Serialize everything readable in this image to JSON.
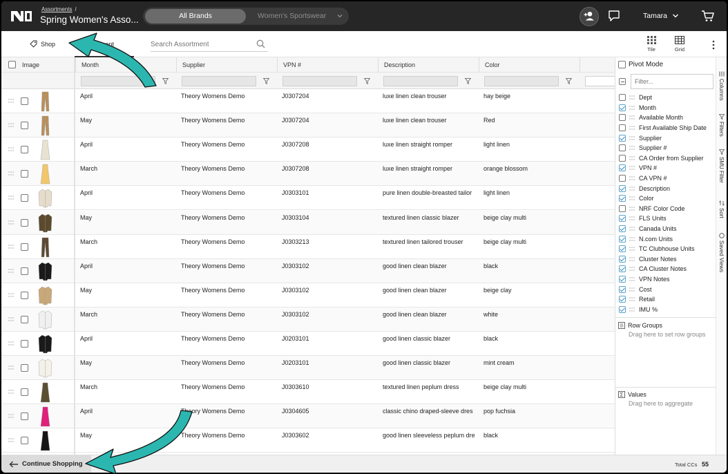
{
  "header": {
    "breadcrumb": "Assortments",
    "breadcrumb_sep": "/",
    "title": "Spring Women's Asso...",
    "brand_active": "All Brands",
    "brand_other": "Women's Sportswear",
    "user_name": "Tamara"
  },
  "toolbar": {
    "shop_label": "Shop",
    "assortment_label": "ment",
    "search_placeholder": "Search Assortment",
    "tile_label": "Tile",
    "grid_label": "Grid"
  },
  "grid": {
    "columns": [
      "Image",
      "Month",
      "Supplier",
      "VPN #",
      "Description",
      "Color"
    ],
    "rows": [
      {
        "month": "April",
        "supplier": "Theory Womens Demo",
        "vpn": "J0307204",
        "description": "luxe linen clean trouser",
        "color": "hay beige",
        "swatch": "#b8905e",
        "shape": "pants"
      },
      {
        "month": "May",
        "supplier": "Theory Womens Demo",
        "vpn": "J0307204",
        "description": "luxe linen clean trouser",
        "color": "Red",
        "swatch": "#b8905e",
        "shape": "pants"
      },
      {
        "month": "April",
        "supplier": "Theory Womens Demo",
        "vpn": "J0307208",
        "description": "luxe linen straight romper",
        "color": "light linen",
        "swatch": "#e8e2d0",
        "shape": "dress"
      },
      {
        "month": "March",
        "supplier": "Theory Womens Demo",
        "vpn": "J0307208",
        "description": "luxe linen straight romper",
        "color": "orange blossom",
        "swatch": "#f2c76b",
        "shape": "dress"
      },
      {
        "month": "April",
        "supplier": "Theory Womens Demo",
        "vpn": "J0303101",
        "description": "pure linen double-breasted tailor",
        "color": "light linen",
        "swatch": "#e6dccb",
        "shape": "jacket"
      },
      {
        "month": "May",
        "supplier": "Theory Womens Demo",
        "vpn": "J0303104",
        "description": "textured linen classic blazer",
        "color": "beige clay multi",
        "swatch": "#5a4a2e",
        "shape": "jacket"
      },
      {
        "month": "March",
        "supplier": "Theory Womens Demo",
        "vpn": "J0303213",
        "description": "textured linen tailored trouser",
        "color": "beige clay multi",
        "swatch": "#5c4a34",
        "shape": "pants"
      },
      {
        "month": "April",
        "supplier": "Theory Womens Demo",
        "vpn": "J0303102",
        "description": "good linen clean blazer",
        "color": "black",
        "swatch": "#1a1a1a",
        "shape": "jacket"
      },
      {
        "month": "May",
        "supplier": "Theory Womens Demo",
        "vpn": "J0303102",
        "description": "good linen clean blazer",
        "color": "beige clay",
        "swatch": "#c9a878",
        "shape": "jacket"
      },
      {
        "month": "March",
        "supplier": "Theory Womens Demo",
        "vpn": "J0303102",
        "description": "good linen clean blazer",
        "color": "white",
        "swatch": "#f0f0f0",
        "shape": "jacket"
      },
      {
        "month": "April",
        "supplier": "Theory Womens Demo",
        "vpn": "J0203101",
        "description": "good linen classic blazer",
        "color": "black",
        "swatch": "#1a1a1a",
        "shape": "jacket"
      },
      {
        "month": "May",
        "supplier": "Theory Womens Demo",
        "vpn": "J0203101",
        "description": "good linen classic blazer",
        "color": "mint cream",
        "swatch": "#f3f1e8",
        "shape": "jacket"
      },
      {
        "month": "March",
        "supplier": "Theory Womens Demo",
        "vpn": "J0303610",
        "description": "textured linen peplum dress",
        "color": "beige clay multi",
        "swatch": "#5b4f32",
        "shape": "dress"
      },
      {
        "month": "April",
        "supplier": "Theory Womens Demo",
        "vpn": "J0304605",
        "description": "classic chino draped-sleeve dres",
        "color": "pop fuchsia",
        "swatch": "#e0207a",
        "shape": "dress"
      },
      {
        "month": "May",
        "supplier": "Theory Womens Demo",
        "vpn": "J0303602",
        "description": "good linen sleeveless peplum dre",
        "color": "black",
        "swatch": "#161616",
        "shape": "dress"
      }
    ]
  },
  "panel": {
    "pivot_label": "Pivot Mode",
    "filter_placeholder": "Filter...",
    "columns": [
      {
        "label": "Dept",
        "checked": false
      },
      {
        "label": "Month",
        "checked": true
      },
      {
        "label": "Available Month",
        "checked": false
      },
      {
        "label": "First Available Ship Date",
        "checked": false
      },
      {
        "label": "Supplier",
        "checked": true
      },
      {
        "label": "Supplier #",
        "checked": false
      },
      {
        "label": "CA Order from Supplier",
        "checked": false
      },
      {
        "label": "VPN #",
        "checked": true
      },
      {
        "label": "CA VPN #",
        "checked": false
      },
      {
        "label": "Description",
        "checked": true
      },
      {
        "label": "Color",
        "checked": true
      },
      {
        "label": "NRF Color Code",
        "checked": false
      },
      {
        "label": "FLS Units",
        "checked": true
      },
      {
        "label": "Canada Units",
        "checked": true
      },
      {
        "label": "N.com Units",
        "checked": true
      },
      {
        "label": "TC Clubhouse Units",
        "checked": true
      },
      {
        "label": "Cluster Notes",
        "checked": true
      },
      {
        "label": "CA Cluster Notes",
        "checked": true
      },
      {
        "label": "VPN Notes",
        "checked": true
      },
      {
        "label": "Cost",
        "checked": true
      },
      {
        "label": "Retail",
        "checked": true
      },
      {
        "label": "IMU %",
        "checked": true
      }
    ],
    "row_groups_label": "Row Groups",
    "row_groups_hint": "Drag here to set row groups",
    "values_label": "Values",
    "values_hint": "Drag here to aggregate",
    "side_tabs": [
      "Columns",
      "Filters",
      "SMU Filter",
      "Sort",
      "Saved Views"
    ]
  },
  "footer": {
    "continue_label": "Continue Shopping",
    "total_label": "Total CCs",
    "total_value": "55"
  },
  "colors": {
    "topbar": "#262626",
    "annotation_arrow": "#2bb7b0",
    "checkbox_accent": "#3d8fbf"
  }
}
